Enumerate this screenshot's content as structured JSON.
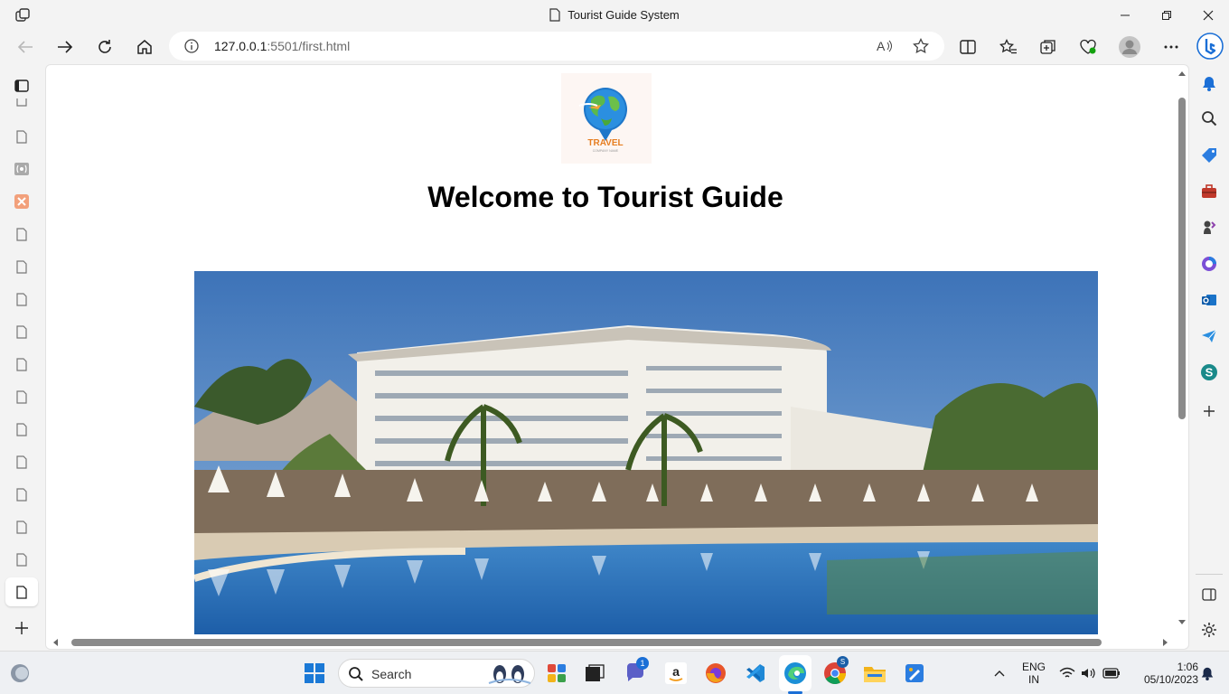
{
  "window": {
    "title": "Tourist Guide System"
  },
  "toolbar": {
    "url_host": "127.0.0.1",
    "url_rest": ":5501/first.html"
  },
  "page": {
    "logo_text": "TRAVEL",
    "logo_subtext": "COMPANY NAME",
    "heading": "Welcome to Tourist Guide"
  },
  "taskbar": {
    "search_label": "Search",
    "teams_badge": "1",
    "chrome_badge": "S",
    "language_line1": "ENG",
    "language_line2": "IN",
    "time": "1:06",
    "date": "05/10/2023"
  },
  "colors": {
    "accent": "#0067c0",
    "chrome_bg": "#f3f3f3"
  }
}
